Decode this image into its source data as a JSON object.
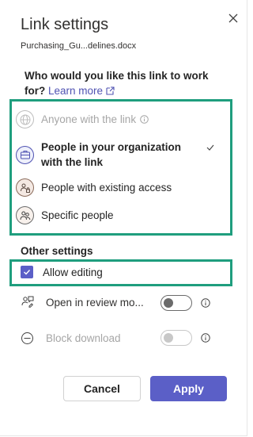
{
  "dialog": {
    "title": "Link settings",
    "filename": "Purchasing_Gu...delines.docx",
    "question": "Who would you like this link to work for?",
    "learn_more": "Learn more"
  },
  "options": [
    {
      "label": "Anyone with the link",
      "icon": "globe-icon",
      "state": "disabled"
    },
    {
      "label": "People in your organization with the link",
      "icon": "briefcase-icon",
      "state": "selected"
    },
    {
      "label": "People with existing access",
      "icon": "people-lock-icon",
      "state": "normal"
    },
    {
      "label": "Specific people",
      "icon": "people-icon",
      "state": "normal"
    }
  ],
  "other_settings": {
    "title": "Other settings",
    "allow_editing": {
      "label": "Allow editing",
      "checked": true
    },
    "review_mode": {
      "label": "Open in review mo...",
      "on": false
    },
    "block_download": {
      "label": "Block download",
      "on": false,
      "disabled": true
    }
  },
  "buttons": {
    "cancel": "Cancel",
    "apply": "Apply"
  },
  "colors": {
    "accent": "#5b5fc7",
    "highlight": "#1f9e7e",
    "link": "#4f52b2"
  }
}
